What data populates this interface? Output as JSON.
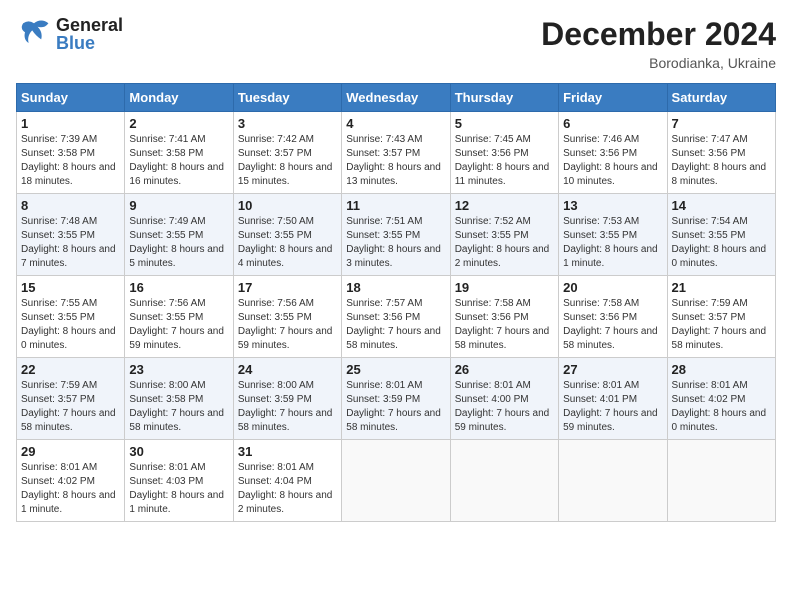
{
  "header": {
    "logo_general": "General",
    "logo_blue": "Blue",
    "month_year": "December 2024",
    "location": "Borodianka, Ukraine"
  },
  "columns": [
    "Sunday",
    "Monday",
    "Tuesday",
    "Wednesday",
    "Thursday",
    "Friday",
    "Saturday"
  ],
  "weeks": [
    [
      {
        "day": "1",
        "sunrise": "Sunrise: 7:39 AM",
        "sunset": "Sunset: 3:58 PM",
        "daylight": "Daylight: 8 hours and 18 minutes."
      },
      {
        "day": "2",
        "sunrise": "Sunrise: 7:41 AM",
        "sunset": "Sunset: 3:58 PM",
        "daylight": "Daylight: 8 hours and 16 minutes."
      },
      {
        "day": "3",
        "sunrise": "Sunrise: 7:42 AM",
        "sunset": "Sunset: 3:57 PM",
        "daylight": "Daylight: 8 hours and 15 minutes."
      },
      {
        "day": "4",
        "sunrise": "Sunrise: 7:43 AM",
        "sunset": "Sunset: 3:57 PM",
        "daylight": "Daylight: 8 hours and 13 minutes."
      },
      {
        "day": "5",
        "sunrise": "Sunrise: 7:45 AM",
        "sunset": "Sunset: 3:56 PM",
        "daylight": "Daylight: 8 hours and 11 minutes."
      },
      {
        "day": "6",
        "sunrise": "Sunrise: 7:46 AM",
        "sunset": "Sunset: 3:56 PM",
        "daylight": "Daylight: 8 hours and 10 minutes."
      },
      {
        "day": "7",
        "sunrise": "Sunrise: 7:47 AM",
        "sunset": "Sunset: 3:56 PM",
        "daylight": "Daylight: 8 hours and 8 minutes."
      }
    ],
    [
      {
        "day": "8",
        "sunrise": "Sunrise: 7:48 AM",
        "sunset": "Sunset: 3:55 PM",
        "daylight": "Daylight: 8 hours and 7 minutes."
      },
      {
        "day": "9",
        "sunrise": "Sunrise: 7:49 AM",
        "sunset": "Sunset: 3:55 PM",
        "daylight": "Daylight: 8 hours and 5 minutes."
      },
      {
        "day": "10",
        "sunrise": "Sunrise: 7:50 AM",
        "sunset": "Sunset: 3:55 PM",
        "daylight": "Daylight: 8 hours and 4 minutes."
      },
      {
        "day": "11",
        "sunrise": "Sunrise: 7:51 AM",
        "sunset": "Sunset: 3:55 PM",
        "daylight": "Daylight: 8 hours and 3 minutes."
      },
      {
        "day": "12",
        "sunrise": "Sunrise: 7:52 AM",
        "sunset": "Sunset: 3:55 PM",
        "daylight": "Daylight: 8 hours and 2 minutes."
      },
      {
        "day": "13",
        "sunrise": "Sunrise: 7:53 AM",
        "sunset": "Sunset: 3:55 PM",
        "daylight": "Daylight: 8 hours and 1 minute."
      },
      {
        "day": "14",
        "sunrise": "Sunrise: 7:54 AM",
        "sunset": "Sunset: 3:55 PM",
        "daylight": "Daylight: 8 hours and 0 minutes."
      }
    ],
    [
      {
        "day": "15",
        "sunrise": "Sunrise: 7:55 AM",
        "sunset": "Sunset: 3:55 PM",
        "daylight": "Daylight: 8 hours and 0 minutes."
      },
      {
        "day": "16",
        "sunrise": "Sunrise: 7:56 AM",
        "sunset": "Sunset: 3:55 PM",
        "daylight": "Daylight: 7 hours and 59 minutes."
      },
      {
        "day": "17",
        "sunrise": "Sunrise: 7:56 AM",
        "sunset": "Sunset: 3:55 PM",
        "daylight": "Daylight: 7 hours and 59 minutes."
      },
      {
        "day": "18",
        "sunrise": "Sunrise: 7:57 AM",
        "sunset": "Sunset: 3:56 PM",
        "daylight": "Daylight: 7 hours and 58 minutes."
      },
      {
        "day": "19",
        "sunrise": "Sunrise: 7:58 AM",
        "sunset": "Sunset: 3:56 PM",
        "daylight": "Daylight: 7 hours and 58 minutes."
      },
      {
        "day": "20",
        "sunrise": "Sunrise: 7:58 AM",
        "sunset": "Sunset: 3:56 PM",
        "daylight": "Daylight: 7 hours and 58 minutes."
      },
      {
        "day": "21",
        "sunrise": "Sunrise: 7:59 AM",
        "sunset": "Sunset: 3:57 PM",
        "daylight": "Daylight: 7 hours and 58 minutes."
      }
    ],
    [
      {
        "day": "22",
        "sunrise": "Sunrise: 7:59 AM",
        "sunset": "Sunset: 3:57 PM",
        "daylight": "Daylight: 7 hours and 58 minutes."
      },
      {
        "day": "23",
        "sunrise": "Sunrise: 8:00 AM",
        "sunset": "Sunset: 3:58 PM",
        "daylight": "Daylight: 7 hours and 58 minutes."
      },
      {
        "day": "24",
        "sunrise": "Sunrise: 8:00 AM",
        "sunset": "Sunset: 3:59 PM",
        "daylight": "Daylight: 7 hours and 58 minutes."
      },
      {
        "day": "25",
        "sunrise": "Sunrise: 8:01 AM",
        "sunset": "Sunset: 3:59 PM",
        "daylight": "Daylight: 7 hours and 58 minutes."
      },
      {
        "day": "26",
        "sunrise": "Sunrise: 8:01 AM",
        "sunset": "Sunset: 4:00 PM",
        "daylight": "Daylight: 7 hours and 59 minutes."
      },
      {
        "day": "27",
        "sunrise": "Sunrise: 8:01 AM",
        "sunset": "Sunset: 4:01 PM",
        "daylight": "Daylight: 7 hours and 59 minutes."
      },
      {
        "day": "28",
        "sunrise": "Sunrise: 8:01 AM",
        "sunset": "Sunset: 4:02 PM",
        "daylight": "Daylight: 8 hours and 0 minutes."
      }
    ],
    [
      {
        "day": "29",
        "sunrise": "Sunrise: 8:01 AM",
        "sunset": "Sunset: 4:02 PM",
        "daylight": "Daylight: 8 hours and 1 minute."
      },
      {
        "day": "30",
        "sunrise": "Sunrise: 8:01 AM",
        "sunset": "Sunset: 4:03 PM",
        "daylight": "Daylight: 8 hours and 1 minute."
      },
      {
        "day": "31",
        "sunrise": "Sunrise: 8:01 AM",
        "sunset": "Sunset: 4:04 PM",
        "daylight": "Daylight: 8 hours and 2 minutes."
      },
      null,
      null,
      null,
      null
    ]
  ]
}
